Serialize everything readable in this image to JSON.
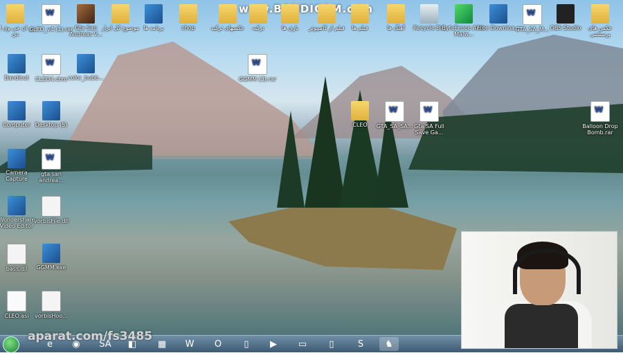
{
  "watermarks": {
    "top": "www.BANDICAM.com",
    "bottom": "aparat.com/fs3485"
  },
  "desktop_icons": [
    {
      "id": "i1",
      "label": "پن ان جی وی ان دی",
      "icon": "folder-icon"
    },
    {
      "id": "i2",
      "label": "CLEO_v4 (1).rar",
      "icon": "document-icon"
    },
    {
      "id": "i3",
      "label": "Gta San Andreas V...",
      "icon": "game-icon"
    },
    {
      "id": "i4",
      "label": "موضوع كل ابزار",
      "icon": "folder-icon"
    },
    {
      "id": "i5",
      "label": "برنامه ها",
      "icon": "app-icon"
    },
    {
      "id": "i6",
      "label": "shop",
      "icon": "folder-icon"
    },
    {
      "id": "i7",
      "label": "عكسهای ترکیه",
      "icon": "folder-icon"
    },
    {
      "id": "i8",
      "label": "ترکیه",
      "icon": "folder-icon"
    },
    {
      "id": "i9",
      "label": "بازی ها",
      "icon": "folder-icon"
    },
    {
      "id": "i10",
      "label": "فیلم از کامپیوتر",
      "icon": "folder-icon"
    },
    {
      "id": "i11",
      "label": "فیلم ها",
      "icon": "folder-icon"
    },
    {
      "id": "i12",
      "label": "آهنگ ها",
      "icon": "folder-icon"
    },
    {
      "id": "i13",
      "label": "Recycle Bin",
      "icon": "recycle-bin-icon"
    },
    {
      "id": "i14",
      "label": "ByteFence Anti-Malw...",
      "icon": "shield-icon"
    },
    {
      "id": "i15",
      "label": "Free Downloa...",
      "icon": "download-icon"
    },
    {
      "id": "i16",
      "label": "GTA_SA_M...",
      "icon": "document-icon"
    },
    {
      "id": "i17",
      "label": "OBS Studio",
      "icon": "obs-icon"
    },
    {
      "id": "i18",
      "label": "عکس های پرسشنی",
      "icon": "folder-icon"
    },
    {
      "id": "i19",
      "label": "Bandicut",
      "icon": "app-icon"
    },
    {
      "id": "i20",
      "label": "CLEO4.chm",
      "icon": "help-file-icon"
    },
    {
      "id": "i21",
      "label": "color_bubb...",
      "icon": "app-icon"
    },
    {
      "id": "i22",
      "label": "GGMM (3).rar",
      "icon": "document-icon"
    },
    {
      "id": "i23",
      "label": "Computer",
      "icon": "computer-icon"
    },
    {
      "id": "i24",
      "label": "Desktop (5)",
      "icon": "monitor-icon"
    },
    {
      "id": "i25",
      "label": "CLEO",
      "icon": "folder-icon"
    },
    {
      "id": "i26",
      "label": "GTA_SA_SA...",
      "icon": "document-icon"
    },
    {
      "id": "i27",
      "label": "Gta SA Full Save Ga...",
      "icon": "document-icon"
    },
    {
      "id": "i28",
      "label": "Balloon Drop Bomb.rar",
      "icon": "document-icon"
    },
    {
      "id": "i29",
      "label": "Camera Capture",
      "icon": "webcam-icon"
    },
    {
      "id": "i30",
      "label": "gta san andrea...",
      "icon": "document-icon"
    },
    {
      "id": "i31",
      "label": "Wondershare Video Editor",
      "icon": "app-icon"
    },
    {
      "id": "i32",
      "label": "vorbisFile.dll",
      "icon": "dll-icon"
    },
    {
      "id": "i33",
      "label": "bass.dll",
      "icon": "dll-icon"
    },
    {
      "id": "i34",
      "label": "GGMM.exe",
      "icon": "gear-icon"
    },
    {
      "id": "i35",
      "label": "CLEO.asi",
      "icon": "blank-file-icon"
    },
    {
      "id": "i36",
      "label": "vorbisHoo...",
      "icon": "dll-icon"
    }
  ],
  "taskbar": {
    "start": "start-button",
    "items": [
      {
        "id": "t1",
        "icon": "internet-explorer-icon",
        "glyph": "e"
      },
      {
        "id": "t2",
        "icon": "chrome-icon",
        "glyph": "◉"
      },
      {
        "id": "t3",
        "icon": "game-sa-icon",
        "glyph": "SA"
      },
      {
        "id": "t4",
        "icon": "app-icon",
        "glyph": "◧"
      },
      {
        "id": "t5",
        "icon": "file-explorer-icon",
        "glyph": "▦"
      },
      {
        "id": "t6",
        "icon": "word-icon",
        "glyph": "W"
      },
      {
        "id": "t7",
        "icon": "opera-icon",
        "glyph": "O"
      },
      {
        "id": "t8",
        "icon": "blank-file-icon",
        "glyph": "▯"
      },
      {
        "id": "t9",
        "icon": "media-player-icon",
        "glyph": "▶"
      },
      {
        "id": "t10",
        "icon": "monitor-icon",
        "glyph": "▭"
      },
      {
        "id": "t11",
        "icon": "blank-file-icon",
        "glyph": "▯"
      },
      {
        "id": "t12",
        "icon": "skype-icon",
        "glyph": "S"
      },
      {
        "id": "t13",
        "icon": "game-icon",
        "glyph": "♞"
      }
    ]
  }
}
